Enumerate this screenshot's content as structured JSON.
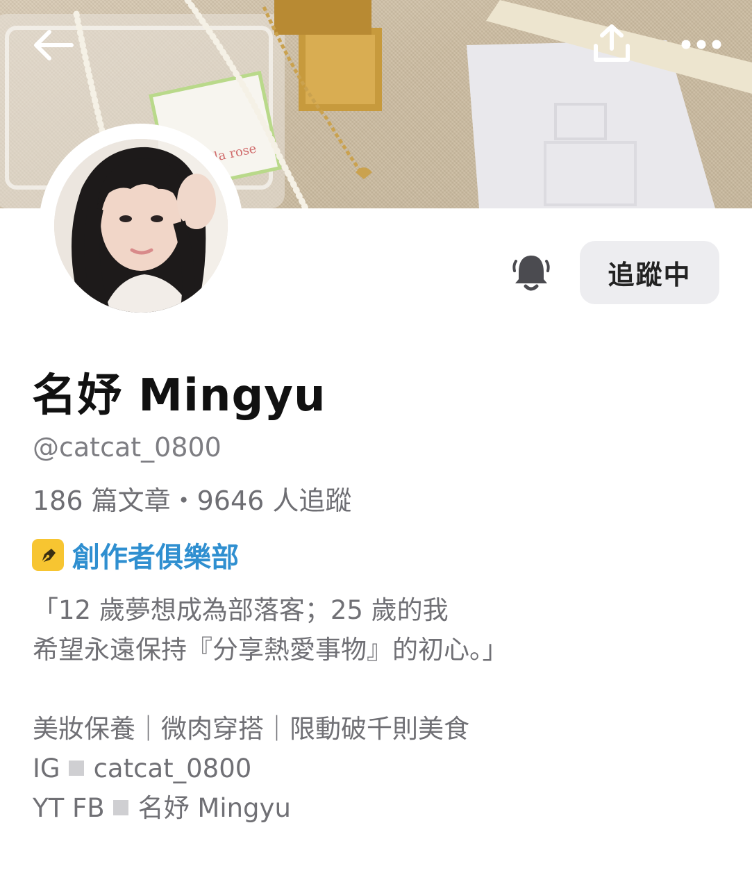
{
  "header": {
    "back_icon": "arrow-left-icon",
    "share_icon": "share-upload-icon",
    "more_icon": "more-dots-icon"
  },
  "profile": {
    "name": "名妤 Mingyu",
    "handle": "@catcat_0800",
    "stats": "186 篇文章・9646 人追蹤",
    "club_label": "創作者俱樂部",
    "follow_button": "追蹤中"
  },
  "bio": {
    "line1": "「12 歲夢想成為部落客；25 歲的我",
    "line2": "希望永遠保持『分享熱愛事物』的初心。」",
    "line3": "美妝保養｜微肉穿搭｜限動破千則美食",
    "ig_label": "IG",
    "ig_value": "catcat_0800",
    "yt_label": "YT FB",
    "yt_value": "名妤 Mingyu"
  },
  "colors": {
    "accent_link": "#2f8fd0",
    "badge": "#f7c531",
    "follow_bg": "#ededf0",
    "muted_text": "#707075"
  }
}
